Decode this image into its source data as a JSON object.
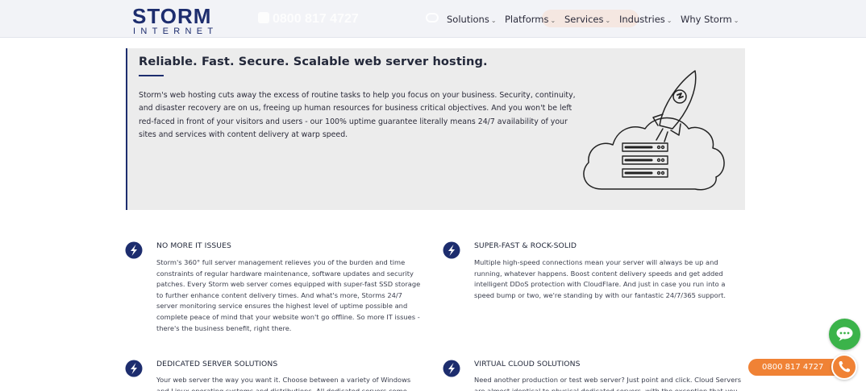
{
  "header": {
    "logo_main": "STORM",
    "logo_sub": "INTERNET",
    "phone_ghost": "0800 817 4727",
    "nav": [
      {
        "label": "Solutions"
      },
      {
        "label": "Platforms"
      },
      {
        "label": "Services"
      },
      {
        "label": "Industries"
      },
      {
        "label": "Why Storm"
      }
    ]
  },
  "hero": {
    "title": "Reliable. Fast. Secure. Scalable web server hosting.",
    "body": "Storm's web hosting cuts away the excess of routine tasks to help you focus on your business. Security, continuity, and disaster recovery are on us, freeing up human resources for business critical objectives. And you won't be left red-faced in front of your visitors and users - our 100% uptime guarantee literally means 24/7 availability of your sites and services with content delivery at warp speed.",
    "illustration_icon": "rocket-cloud-server-icon"
  },
  "features": [
    {
      "title": "NO MORE IT ISSUES",
      "body": "Storm's 360° full server management relieves you of the burden and time constraints of regular hardware maintenance, software updates and security patches. Every Storm web server comes equipped with super-fast SSD storage to further enhance content delivery times. And what's more, Storms 24/7 server monitoring service ensures the highest level of uptime possible and complete peace of mind that your website won't go offline. So more IT issues - there's the business benefit, right there.",
      "icon": "storm-bolt-icon"
    },
    {
      "title": "SUPER-FAST & ROCK-SOLID",
      "body": "Multiple high-speed connections mean your server will always be up and running, whatever happens. Boost content delivery speeds and get added intelligent DDoS protection with CloudFlare. And just in case you run into a speed bump or two, we're standing by with our fantastic 24/7/365 support.",
      "icon": "storm-bolt-icon"
    },
    {
      "title": "DEDICATED SERVER SOLUTIONS",
      "body": "Your web server the way you want it. Choose between a variety of Windows and Linux operating systems and distributions. All dedicated servers come equipped",
      "icon": "storm-bolt-icon"
    },
    {
      "title": "VIRTUAL CLOUD SOLUTIONS",
      "body": "Need another production or test web server? Just point and click. Cloud Servers are almost identical to physical dedicated servers, with the exception that you can",
      "icon": "storm-bolt-icon"
    }
  ],
  "widgets": {
    "call_label": "0800 817 4727",
    "chat_icon": "chat-bubble-icon",
    "phone_icon": "phone-icon"
  },
  "colors": {
    "brand_navy": "#1d2d6e",
    "accent_orange": "#f08235",
    "chat_green": "#3bb34a",
    "hero_bg": "#ececec"
  }
}
